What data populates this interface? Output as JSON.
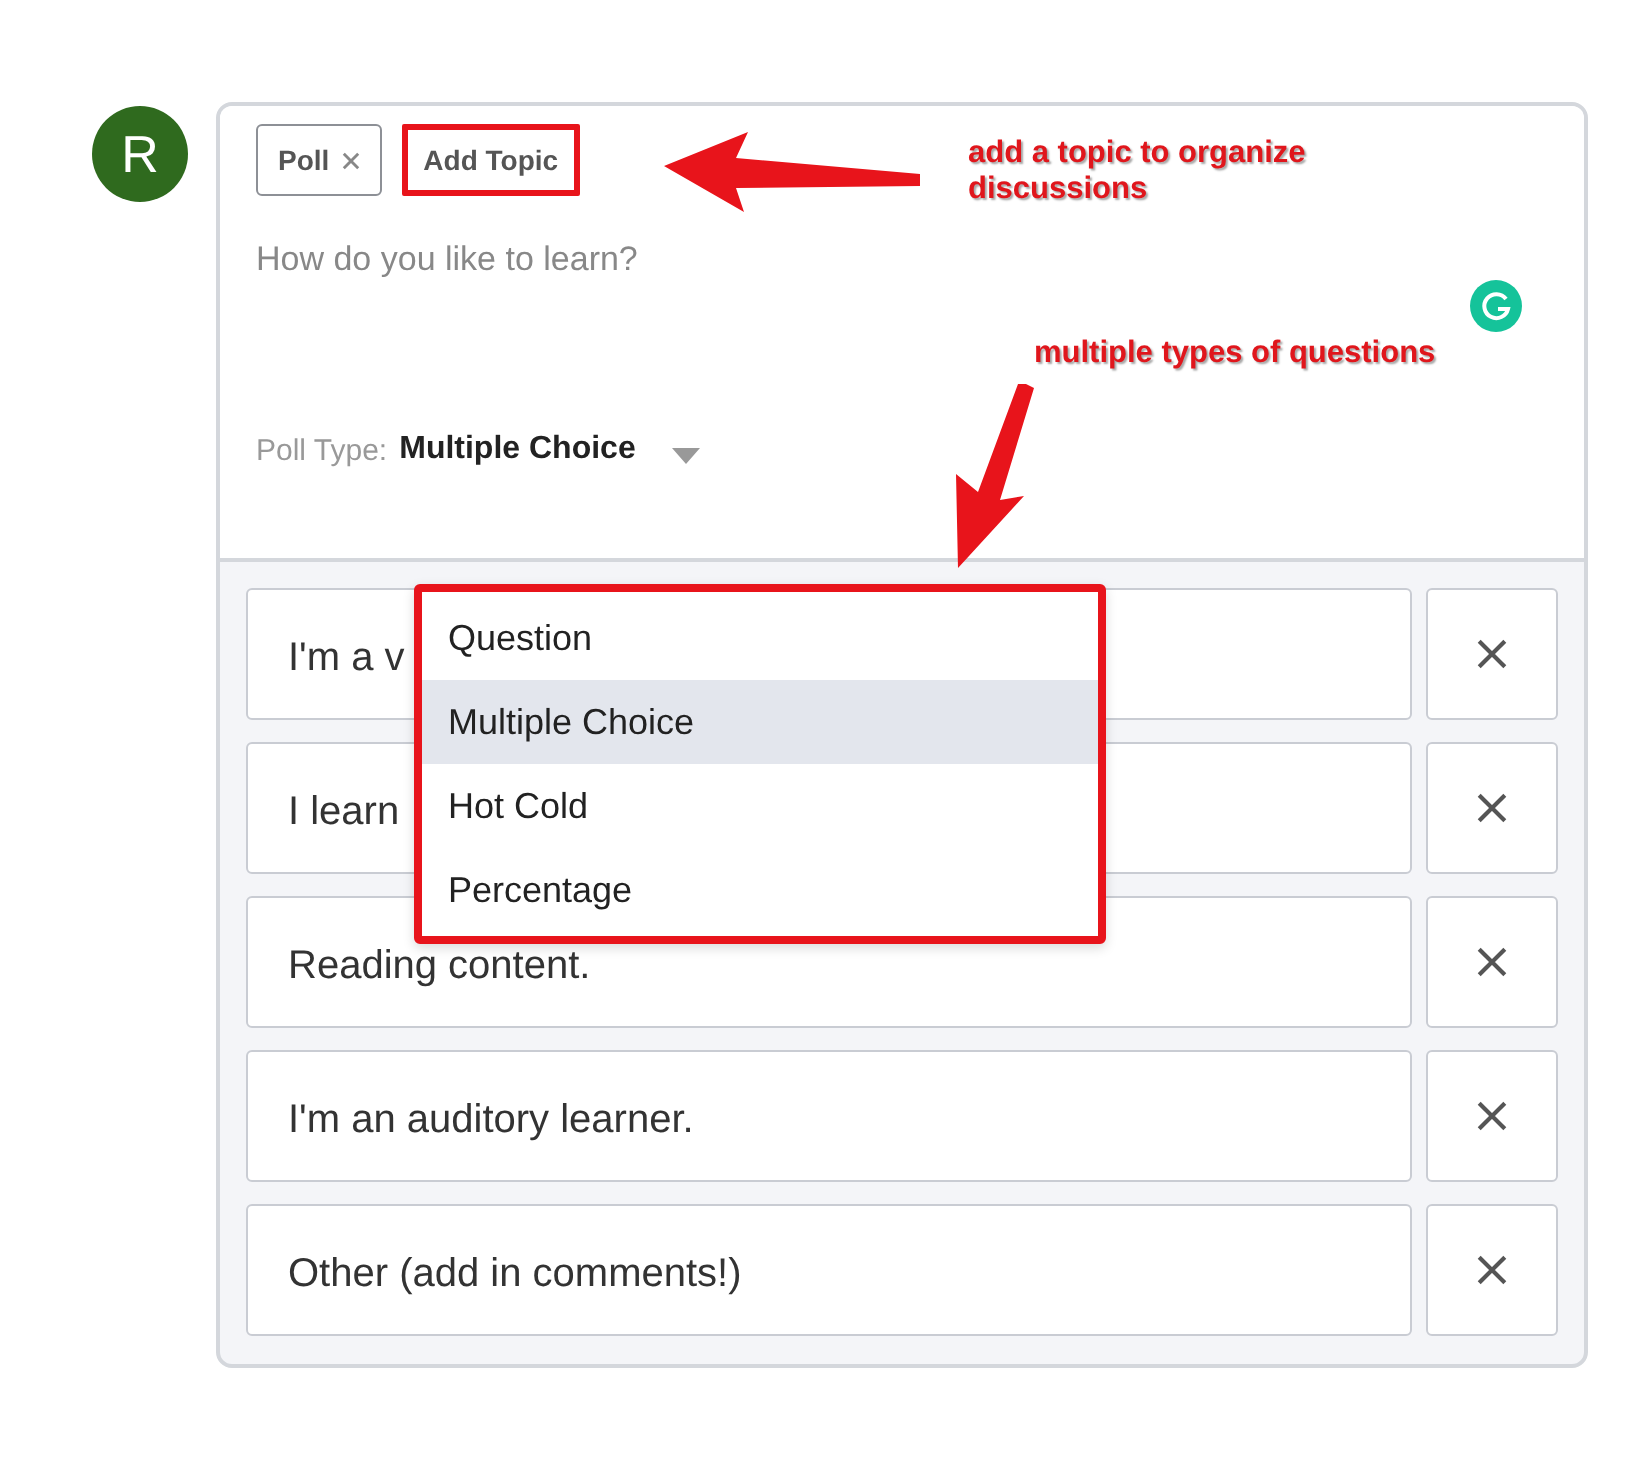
{
  "avatar": {
    "initial": "R"
  },
  "tags": [
    {
      "label": "Poll",
      "removable": true
    },
    {
      "label": "Add Topic",
      "removable": false
    }
  ],
  "question": {
    "placeholder": "How do you like to learn?"
  },
  "poll_type": {
    "label": "Poll Type:",
    "value": "Multiple Choice",
    "expanded": true
  },
  "type_menu": [
    {
      "label": "Question",
      "selected": false
    },
    {
      "label": "Multiple Choice",
      "selected": true
    },
    {
      "label": "Hot Cold",
      "selected": false
    },
    {
      "label": "Percentage",
      "selected": false
    }
  ],
  "options": [
    {
      "value": "I'm a v"
    },
    {
      "value": "I learn"
    },
    {
      "value": "Reading content."
    },
    {
      "value": "I'm an auditory learner."
    },
    {
      "value": "Other (add in comments!)"
    }
  ],
  "annotations": [
    {
      "kind": "topic",
      "text": "add a topic to organize discussions"
    },
    {
      "kind": "types",
      "text": "multiple types of questions"
    }
  ]
}
